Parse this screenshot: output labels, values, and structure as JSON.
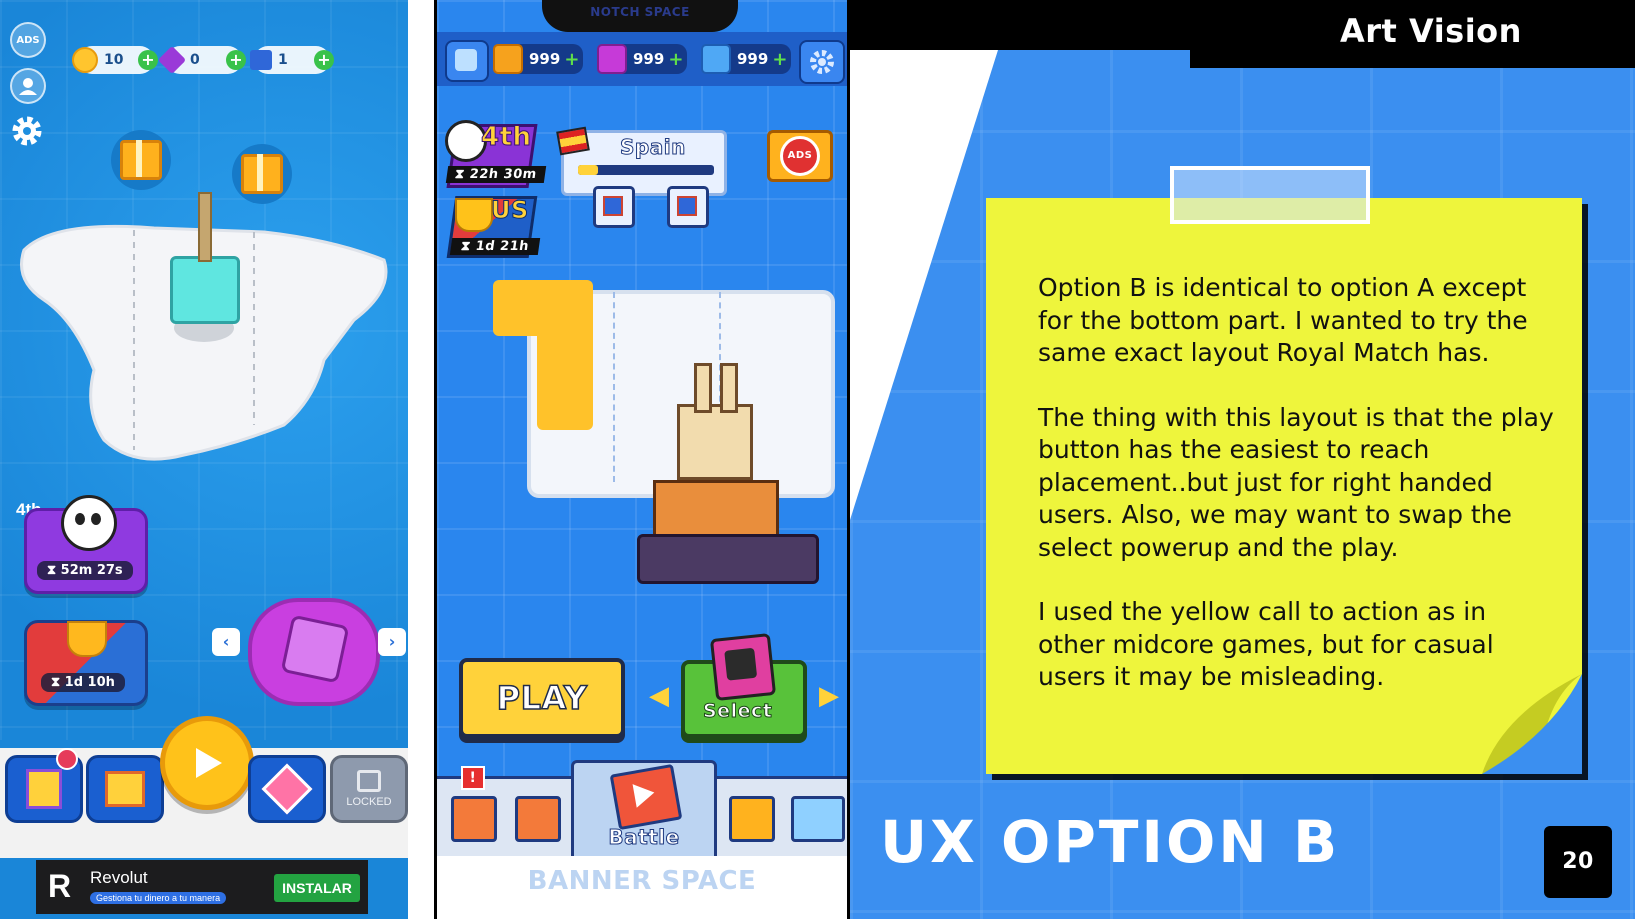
{
  "left_phone": {
    "side_icons": [
      "ads-off-icon",
      "profile-icon",
      "settings-gear-icon"
    ],
    "ads_label": "ADS",
    "currencies": [
      {
        "icon": "coin-icon",
        "value": "10"
      },
      {
        "icon": "gem-icon",
        "value": "0"
      },
      {
        "icon": "skip-ticket-icon",
        "value": "1"
      }
    ],
    "rank_card": {
      "rank": "4th",
      "timer": "52m 27s"
    },
    "trophy_card": {
      "timer": "1d 10h"
    },
    "locked_label": "LOCKED",
    "ad_banner": {
      "brand": "Revolut",
      "tagline": "Gestiona tu dinero a tu manera",
      "cta": "INSTALAR"
    }
  },
  "mid_phone": {
    "notch_label": "NOTCH SPACE",
    "resources": [
      {
        "icon": "coin-block-icon",
        "value": "999"
      },
      {
        "icon": "gem-block-icon",
        "value": "999"
      },
      {
        "icon": "flag-ticket-icon",
        "value": "999"
      }
    ],
    "rank_badge": {
      "rank": "4th",
      "timer": "22h 30m"
    },
    "us_badge": {
      "label": "US",
      "timer": "1d 21h"
    },
    "level_banner": {
      "country": "Spain",
      "progress": 0.15
    },
    "ads_label": "ADS",
    "play_label": "PLAY",
    "select_label": "Select",
    "battle_label": "Battle",
    "banner_label": "BANNER SPACE",
    "alert_badge": "!"
  },
  "slide": {
    "brand": "Art Vision",
    "paragraphs": [
      "Option B is identical to option A except for the bottom part. I wanted to try the same exact layout Royal Match has.",
      "The thing with this layout is that the play button has the easiest to reach placement..but just for right handed users. Also, we may want to swap the select powerup and the play.",
      "I used the yellow call to action as in other midcore games, but for casual users it may be misleading."
    ],
    "title": "UX OPTION B",
    "page_number": "20"
  },
  "colors": {
    "slide_blue": "#3b8ff0",
    "note_yellow": "#eef53c",
    "play_yellow": "#ffd23a",
    "select_green": "#58c23a"
  }
}
